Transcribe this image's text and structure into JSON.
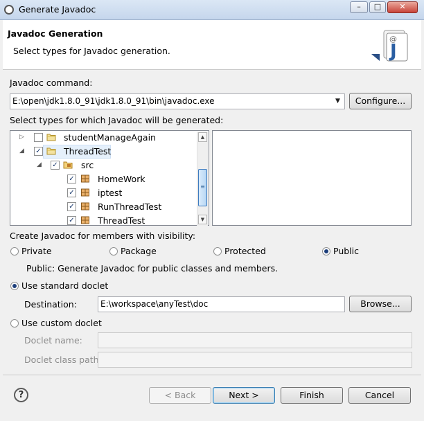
{
  "window": {
    "title": "Generate Javadoc",
    "minimize_glyph": "–",
    "maximize_glyph": "□",
    "close_glyph": "✕"
  },
  "header": {
    "title": "Javadoc Generation",
    "subtitle": "Select types for Javadoc generation.",
    "logo_glyph": "J",
    "logo_at": "@"
  },
  "command": {
    "label": "Javadoc command:",
    "value": "E:\\open\\jdk1.8.0_91\\jdk1.8.0_91\\bin\\javadoc.exe",
    "configure_label": "Configure..."
  },
  "types": {
    "label": "Select types for which Javadoc will be generated:",
    "tree": [
      {
        "label": "studentManageAgain",
        "checked": false,
        "expanded": false
      },
      {
        "label": "ThreadTest",
        "checked": true,
        "expanded": true
      },
      {
        "label": "src",
        "checked": true,
        "expanded": true
      },
      {
        "label": "HomeWork",
        "checked": true
      },
      {
        "label": "iptest",
        "checked": true
      },
      {
        "label": "RunThreadTest",
        "checked": true
      },
      {
        "label": "ThreadTest",
        "checked": true
      }
    ]
  },
  "visibility": {
    "label": "Create Javadoc for members with visibility:",
    "options": [
      "Private",
      "Package",
      "Protected",
      "Public"
    ],
    "selected": "Public",
    "description": "Public: Generate Javadoc for public classes and members."
  },
  "standard_doclet": {
    "label": "Use standard doclet",
    "selected": true,
    "destination_label": "Destination:",
    "destination_value": "E:\\workspace\\anyTest\\doc",
    "browse_label": "Browse..."
  },
  "custom_doclet": {
    "label": "Use custom doclet",
    "selected": false,
    "name_label": "Doclet name:",
    "classpath_label": "Doclet class path:"
  },
  "footer": {
    "help_glyph": "?",
    "back_label": "< Back",
    "next_label": "Next >",
    "finish_label": "Finish",
    "cancel_label": "Cancel"
  },
  "colors": {
    "accent": "#3c7fb1",
    "selected_row": "#e5f0fb"
  }
}
